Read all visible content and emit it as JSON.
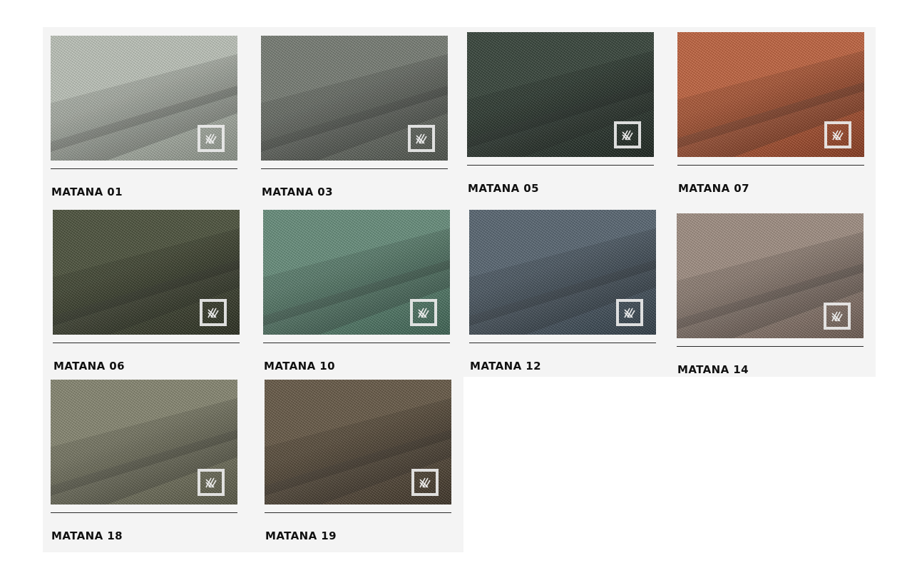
{
  "swatches": [
    {
      "name": "MATANA 01",
      "color": "#c6ccc2",
      "shade": "#8f968c"
    },
    {
      "name": "MATANA 03",
      "color": "#7e837b",
      "shade": "#4f544d"
    },
    {
      "name": "MATANA 05",
      "color": "#3c4a40",
      "shade": "#1e2721"
    },
    {
      "name": "MATANA 07",
      "color": "#c96a45",
      "shade": "#8a3d22"
    },
    {
      "name": "MATANA 06",
      "color": "#525842",
      "shade": "#2c3022"
    },
    {
      "name": "MATANA 10",
      "color": "#6d9582",
      "shade": "#3f6555"
    },
    {
      "name": "MATANA 12",
      "color": "#5e6c78",
      "shade": "#33404a"
    },
    {
      "name": "MATANA 14",
      "color": "#a8968a",
      "shade": "#6f5e55"
    },
    {
      "name": "MATANA 18",
      "color": "#8d8d77",
      "shade": "#5a5a48"
    },
    {
      "name": "MATANA 19",
      "color": "#6d5f4c",
      "shade": "#40362a"
    }
  ]
}
